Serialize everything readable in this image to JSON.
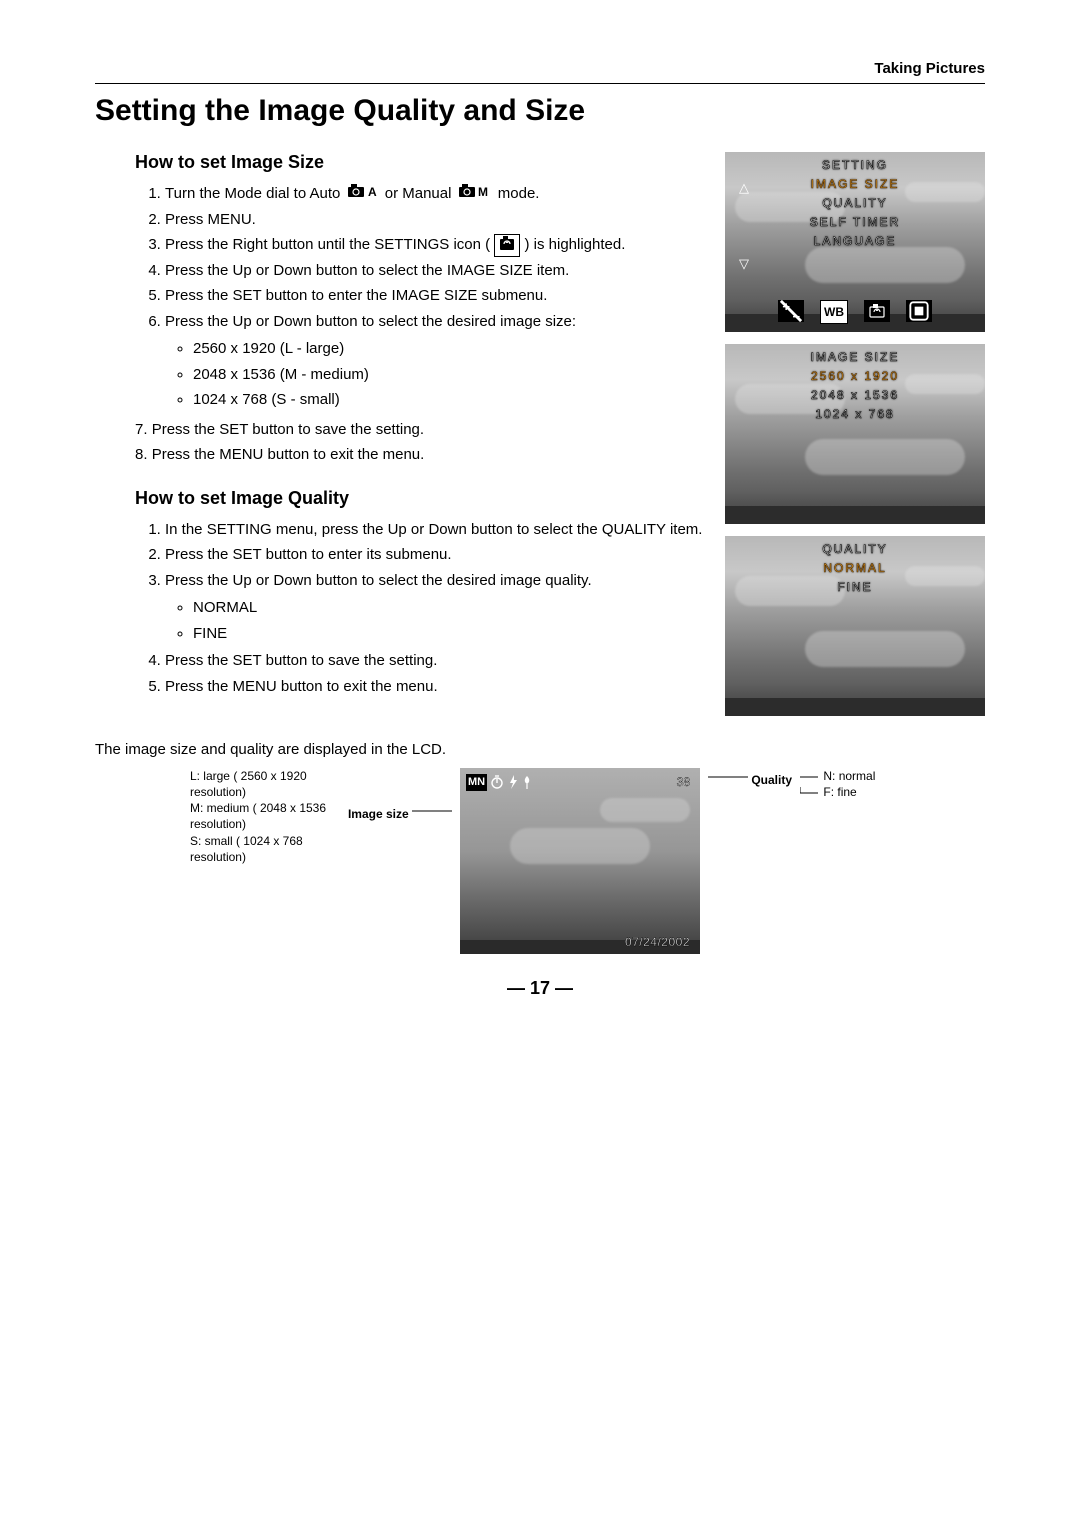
{
  "header": {
    "breadcrumb": "Taking Pictures"
  },
  "title": "Setting the Image Quality and Size",
  "section1": {
    "heading": "How to set Image Size",
    "step1a": "Turn the Mode dial to Auto ",
    "step1b": " or Manual ",
    "step1c": " mode.",
    "step2": "Press MENU.",
    "step3a": "Press the Right button until the SETTINGS icon ( ",
    "step3b": " ) is highlighted.",
    "step4": "Press the Up or Down button to select the IMAGE SIZE item.",
    "step5": "Press the SET button to enter the IMAGE SIZE submenu.",
    "step6": "Press the Up or Down button to select the desired image size:",
    "sizes": [
      "2560 x 1920 (L - large)",
      "2048 x 1536 (M - medium)",
      "1024 x 768 (S - small)"
    ],
    "step7": "Press the SET button to save the setting.",
    "step8": "Press the MENU button to exit the menu."
  },
  "section2": {
    "heading": "How to set Image Quality",
    "step1": "In the SETTING menu, press the Up or Down button to select the QUALITY item.",
    "step2": "Press the SET button to enter its submenu.",
    "step3": "Press the Up or Down button to select the desired image quality.",
    "qualities": [
      "NORMAL",
      "FINE"
    ],
    "step4": "Press the SET button to save the setting.",
    "step5": "Press the MENU button to exit the menu."
  },
  "footnote": "The image size and quality are displayed in the LCD.",
  "lcd1": {
    "title": "SETTING",
    "items": [
      "IMAGE SIZE",
      "QUALITY",
      "SELF TIMER",
      "LANGUAGE"
    ]
  },
  "lcd2": {
    "title": "IMAGE SIZE",
    "items": [
      "2560  x 1920",
      "2048 x 1536",
      "1024 x 768"
    ]
  },
  "lcd3": {
    "title": "QUALITY",
    "items": [
      "NORMAL",
      "FINE"
    ]
  },
  "figure": {
    "left_label_L": "L: large ( 2560 x 1920 resolution)",
    "left_label_M": "M: medium ( 2048 x 1536 resolution)",
    "left_label_S": "S: small ( 1024 x 768 resolution)",
    "image_size_label": "Image size",
    "quality_label": "Quality",
    "right_label_N": "N: normal",
    "right_label_F": "F: fine",
    "hud_badge": "MN",
    "hud_count": "38",
    "hud_date": "07/24/2002"
  },
  "page_number": "— 17 —"
}
